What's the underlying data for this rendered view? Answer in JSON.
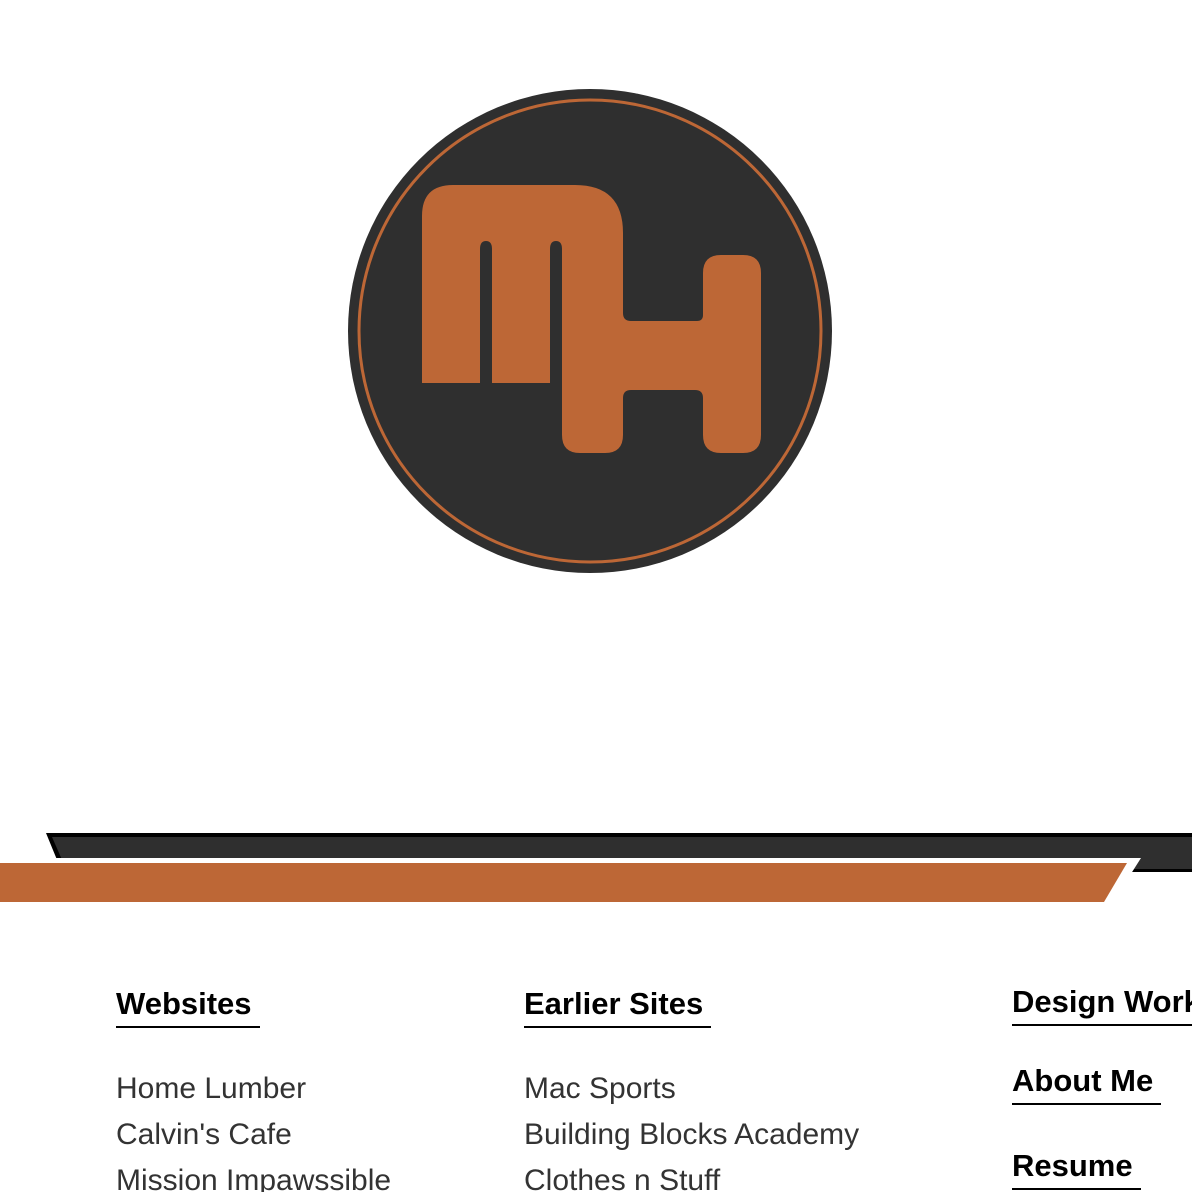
{
  "logo": {
    "initials": "MH",
    "colors": {
      "circle": "#2f2f2f",
      "accent": "#bd6736"
    }
  },
  "band": {
    "colors": {
      "dark": "#2f2f2f",
      "accent": "#bd6736",
      "outline": "#000000"
    }
  },
  "columns": {
    "websites": {
      "heading": "Websites",
      "items": [
        "Home Lumber",
        "Calvin's Cafe",
        "Mission Impawssible"
      ]
    },
    "earlier": {
      "heading": "Earlier Sites",
      "items": [
        "Mac Sports",
        "Building Blocks Academy",
        "Clothes n Stuff"
      ]
    }
  },
  "nav": {
    "design_work": "Design Work",
    "about_me": "About Me",
    "resume": "Resume"
  }
}
